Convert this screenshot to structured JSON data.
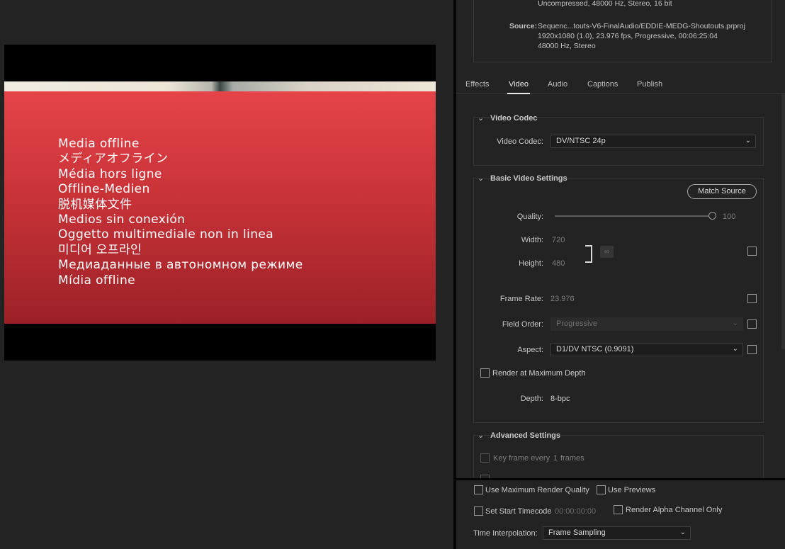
{
  "preview": {
    "offline_lines": [
      "Media offline",
      "メディアオフライン",
      "Média hors ligne",
      "Offline-Medien",
      "脱机媒体文件",
      "Medios sin conexión",
      "Oggetto multimediale non in linea",
      "미디어 오프라인",
      "Медиаданные в автономном режиме",
      "Mídia offline"
    ],
    "offline_color": "#d73a3f"
  },
  "summary": {
    "output_audio_line": "Uncompressed, 48000 Hz, Stereo, 16 bit",
    "source_label": "Source:",
    "source_file": "Sequenc...touts-V6-FinalAudio/EDDIE-MEDG-Shoutouts.prproj",
    "source_video": "1920x1080 (1.0), 23.976 fps, Progressive, 00:06:25:04",
    "source_audio": "48000 Hz, Stereo"
  },
  "tabs": [
    {
      "label": "Effects",
      "active": false
    },
    {
      "label": "Video",
      "active": true
    },
    {
      "label": "Audio",
      "active": false
    },
    {
      "label": "Captions",
      "active": false
    },
    {
      "label": "Publish",
      "active": false
    }
  ],
  "video_codec": {
    "section_title": "Video Codec",
    "codec_label": "Video Codec:",
    "codec_value": "DV/NTSC 24p"
  },
  "basic_settings": {
    "section_title": "Basic Video Settings",
    "match_source_label": "Match Source",
    "quality_label": "Quality:",
    "quality_value": "100",
    "quality_fraction": 1.0,
    "width_label": "Width:",
    "width_value": "720",
    "height_label": "Height:",
    "height_value": "480",
    "frame_rate_label": "Frame Rate:",
    "frame_rate_value": "23.976",
    "field_order_label": "Field Order:",
    "field_order_value": "Progressive",
    "aspect_label": "Aspect:",
    "aspect_value": "D1/DV NTSC (0.9091)",
    "render_max_depth_label": "Render at Maximum Depth",
    "depth_label": "Depth:",
    "depth_value": "8-bpc"
  },
  "advanced_settings": {
    "section_title": "Advanced Settings",
    "keyframe_label": "Key frame every",
    "keyframe_value": "1",
    "keyframe_unit": "frames"
  },
  "bottom": {
    "max_render_quality_label": "Use Maximum Render Quality",
    "use_previews_label": "Use Previews",
    "start_timecode_label": "Set Start Timecode",
    "start_timecode_value": "00:00:00:00",
    "render_alpha_label": "Render Alpha Channel Only",
    "time_interp_label": "Time Interpolation:",
    "time_interp_value": "Frame Sampling"
  },
  "icons": {
    "chevron": "chevron-down-icon",
    "link": "link-icon",
    "dropdown_arrow": "dropdown-arrow-icon"
  }
}
